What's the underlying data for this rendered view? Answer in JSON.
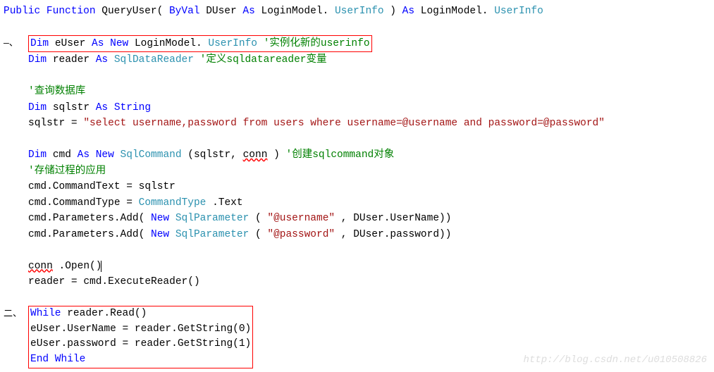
{
  "sig": {
    "public": "Public",
    "function": "Function",
    "name": " QueryUser(",
    "byval": "ByVal",
    "param": " DUser ",
    "as1": "As",
    "ptype1": " LoginModel.",
    "ptype2": "UserInfo",
    "close": ") ",
    "as2": "As",
    "rtype1": " LoginModel.",
    "rtype2": "UserInfo"
  },
  "annot1": "—、",
  "l1": {
    "dim": "Dim",
    "var": " eUser ",
    "as": "As",
    "new": " New",
    "t1": " LoginModel.",
    "t2": "UserInfo",
    "pad": "        ",
    "c": "'实例化新的userinfo"
  },
  "l2": {
    "dim": "Dim",
    "var": " reader ",
    "as": "As",
    "t": " SqlDataReader",
    "pad": "              ",
    "c": "'定义sqldatareader变量"
  },
  "c_query": "'查询数据库",
  "l3": {
    "dim": "Dim",
    "var": " sqlstr ",
    "as": "As",
    "t": " String"
  },
  "l4": {
    "lhs": "sqlstr = ",
    "str": "\"select username,password from users where username=@username and password=@password\""
  },
  "l5": {
    "dim": "Dim",
    "var": " cmd ",
    "as": "As",
    "new": " New",
    "t": " SqlCommand",
    "args1": "(sqlstr, ",
    "conn": "conn",
    "args2": ")",
    "pad": "          ",
    "c": "'创建sqlcommand对象"
  },
  "c_sp": "'存储过程的应用",
  "l6": "cmd.CommandText = sqlstr",
  "l7a": "cmd.CommandType = ",
  "l7b": "CommandType",
  "l7c": ".Text",
  "l8a": "cmd.Parameters.Add(",
  "l8new": "New",
  "l8t": " SqlParameter",
  "l8p1": "(",
  "l8s1": "\"@username\"",
  "l8r1": ", DUser.UserName))",
  "l9s": "\"@password\"",
  "l9r": ", DUser.password))",
  "l10a": "conn",
  "l10b": ".Open()",
  "l11": "reader = cmd.ExecuteReader()",
  "annot2": "二、",
  "w1a": "While",
  "w1b": " reader.Read()",
  "w2": "    eUser.UserName = reader.GetString(0)",
  "w3": "    eUser.password = reader.GetString(1)",
  "w4a": "End",
  "w4b": " While",
  "watermark": "http://blog.csdn.net/u010508826",
  "chart_data": null
}
